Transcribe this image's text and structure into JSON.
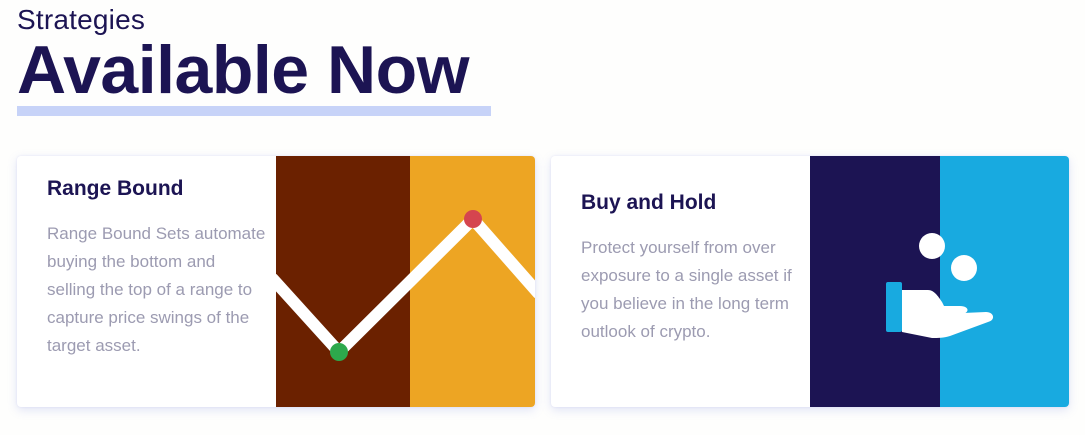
{
  "header": {
    "kicker": "Strategies",
    "title": "Available Now"
  },
  "cards": [
    {
      "title": "Range Bound",
      "description": "Range Bound Sets automate buying the bottom and selling the top of a range to capture price swings of the target asset.",
      "illustration": "range-bound-chart-icon"
    },
    {
      "title": "Buy and Hold",
      "description": "Protect yourself from over exposure to a single asset if you believe in the long term outlook of crypto.",
      "illustration": "hand-holding-coins-icon"
    }
  ],
  "colors": {
    "navy": "#1c1453",
    "underline": "#c7d3f8",
    "brown": "#6b2100",
    "gold": "#eda523",
    "buy_dot": "#2da84c",
    "sell_dot": "#d5454f",
    "sky_blue": "#18aae0",
    "muted_text": "#9c9bb1"
  }
}
